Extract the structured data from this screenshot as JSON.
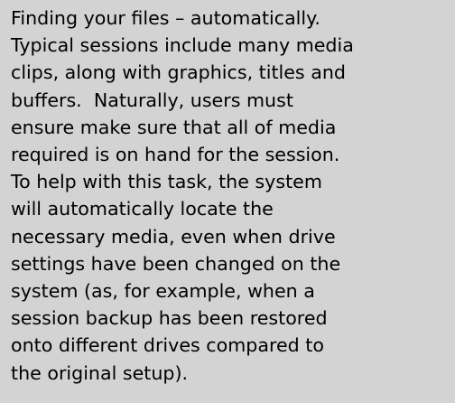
{
  "document": {
    "background_color": "#d3d3d3",
    "text_color": "#000000",
    "lines": [
      "Finding your files – automatically.",
      "Typical sessions include many media",
      "clips, along with graphics, titles and",
      "buffers.  Naturally, users must",
      "ensure make sure that all of media",
      "required is on hand for the session.",
      "To help with this task, the system",
      "will automatically locate the",
      "necessary media, even when drive",
      "settings have been changed on the",
      "system (as, for example, when a",
      "session backup has been restored",
      "onto different drives compared to",
      "the original setup)."
    ]
  }
}
